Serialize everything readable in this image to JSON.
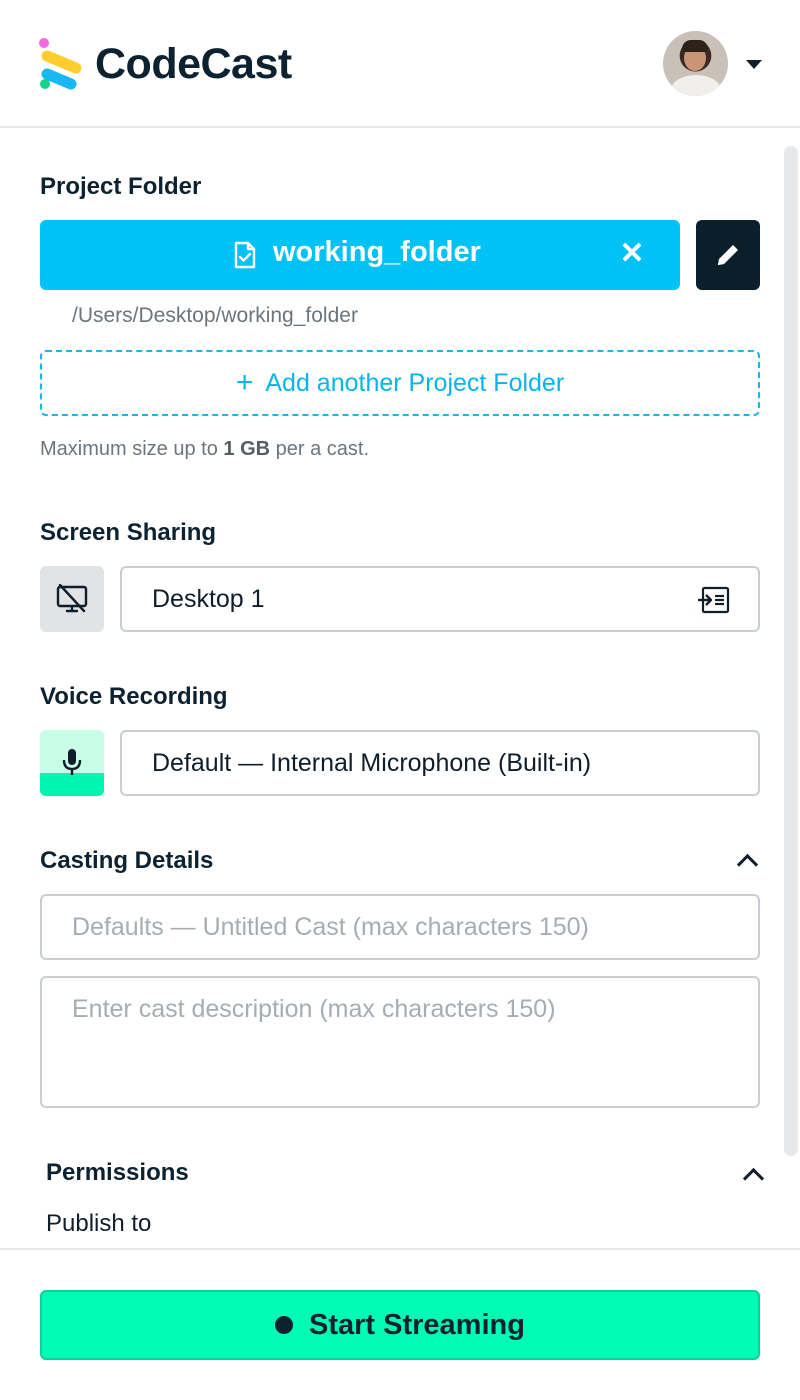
{
  "app": {
    "brand": "CodeCast"
  },
  "header": {
    "menu_icon": "chevron-down-icon",
    "avatar_icon": "user-avatar"
  },
  "project_folder": {
    "label": "Project Folder",
    "folder_name": "working_folder",
    "remove_symbol": "✕",
    "path": "/Users/Desktop/working_folder",
    "add_label": "Add another Project Folder",
    "add_symbol": "+",
    "hint_prefix": "Maximum size up to ",
    "hint_bold": "1 GB",
    "hint_suffix": " per a cast."
  },
  "screen_sharing": {
    "label": "Screen Sharing",
    "value": "Desktop 1"
  },
  "voice_recording": {
    "label": "Voice Recording",
    "value": "Default — Internal Microphone (Built-in)",
    "level": 0.35
  },
  "casting_details": {
    "label": "Casting Details",
    "title_placeholder": "Defaults — Untitled Cast (max characters 150)",
    "description_placeholder": "Enter cast description (max characters 150)"
  },
  "permissions": {
    "label": "Permissions",
    "publish_to_label": "Publish to"
  },
  "footer": {
    "start_label": "Start Streaming"
  },
  "colors": {
    "primary": "#00c2f5",
    "dark": "#0b1f2b",
    "accent": "#00fbb4"
  }
}
